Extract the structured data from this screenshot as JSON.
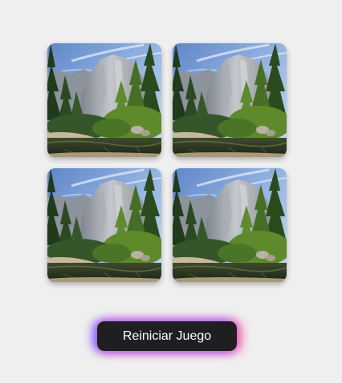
{
  "game": {
    "cards": [
      {
        "name": "card-1",
        "image": "yosemite-valley-landscape",
        "state": "face-up"
      },
      {
        "name": "card-2",
        "image": "yosemite-valley-landscape",
        "state": "face-up"
      },
      {
        "name": "card-3",
        "image": "yosemite-valley-landscape",
        "state": "face-up"
      },
      {
        "name": "card-4",
        "image": "yosemite-valley-landscape",
        "state": "face-up"
      }
    ],
    "restart_label": "Reiniciar Juego"
  },
  "colors": {
    "background": "#efefef",
    "button_bg": "#1f1f22",
    "button_text": "#ffffff",
    "glow_left": "#7c5cff",
    "glow_right": "#ff5caa"
  }
}
